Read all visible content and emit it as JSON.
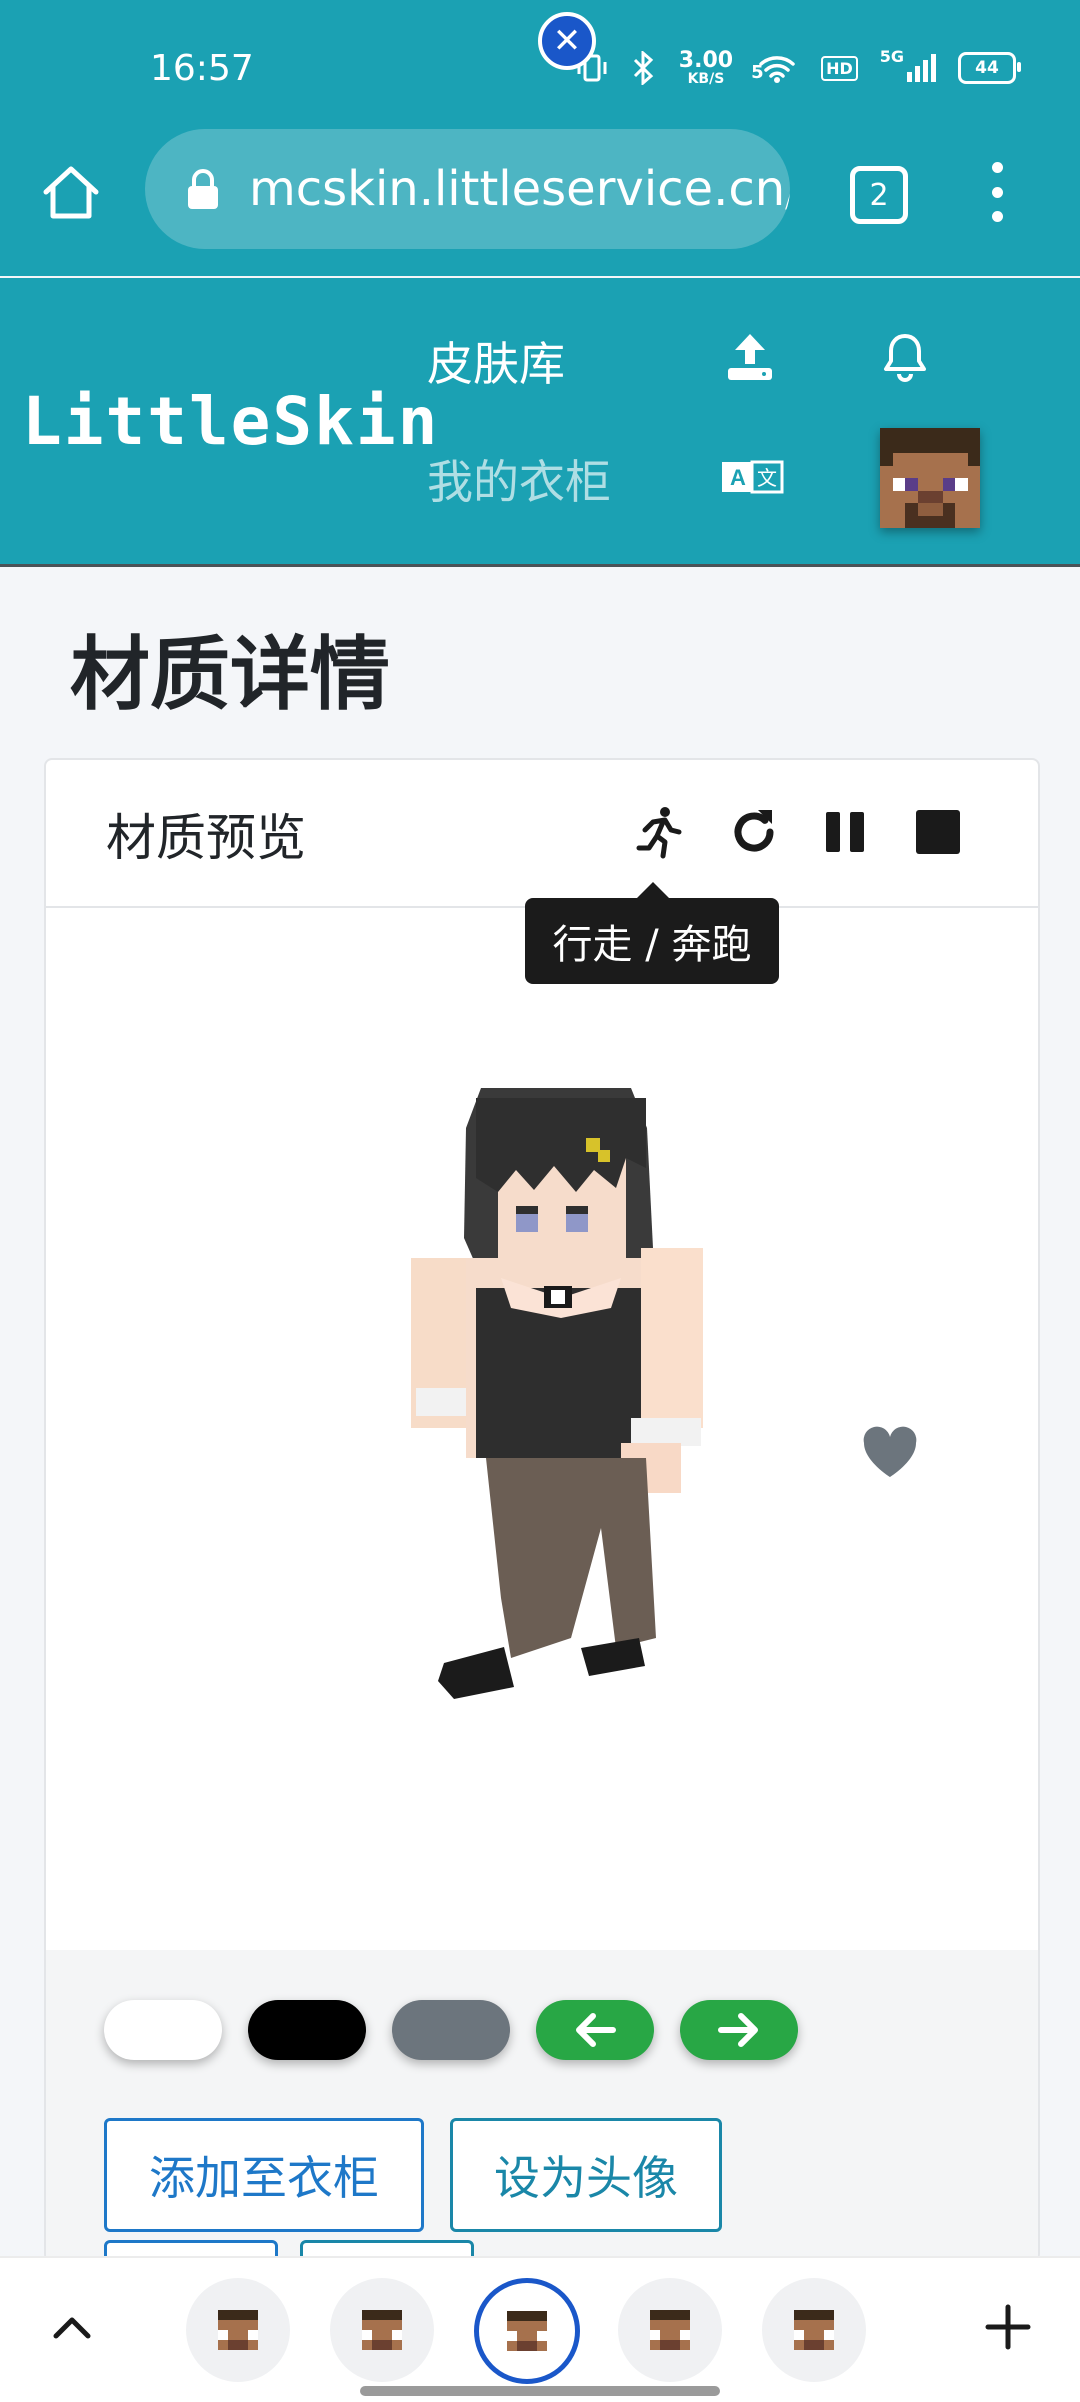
{
  "status_bar": {
    "time": "16:57",
    "net_speed_value": "3.00",
    "net_speed_unit": "KB/S",
    "wifi_label": "5",
    "hd_label": "HD",
    "mobile_label": "5G",
    "battery": "44"
  },
  "browser": {
    "url": "mcskin.littleservice.cn/s",
    "tab_count": "2"
  },
  "site_nav": {
    "brand": "LittleSkin",
    "skinlib": "皮肤库",
    "closet": "我的衣柜"
  },
  "page": {
    "title": "材质详情",
    "preview_title": "材质预览",
    "tooltip": "行走 / 奔跑"
  },
  "background_options": [
    {
      "color": "#ffffff"
    },
    {
      "color": "#000000"
    },
    {
      "color": "#6c757d"
    },
    {
      "color": "#28a745",
      "icon": "arrow-left-icon"
    },
    {
      "color": "#28a745",
      "icon": "arrow-right-icon"
    }
  ],
  "actions": {
    "add_to_closet": "添加至衣柜",
    "set_avatar": "设为头像"
  },
  "colors": {
    "brand": "#1ba1b3",
    "primary_outline": "#1e78c8",
    "success": "#28a745",
    "active_tab": "#1a57c9"
  },
  "tabs": {
    "count": 5,
    "active_index": 2
  }
}
